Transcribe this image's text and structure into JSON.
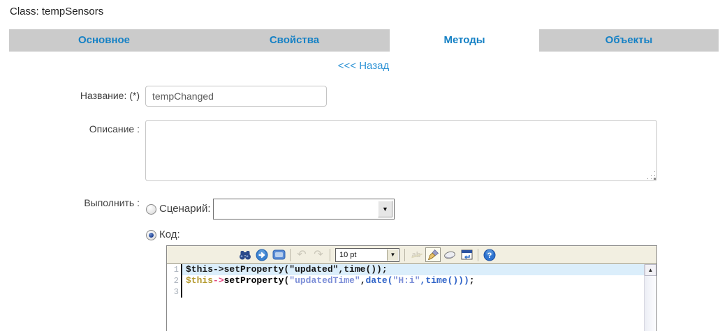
{
  "page": {
    "title": "Class: tempSensors"
  },
  "tabs": [
    {
      "label": "Основное",
      "active": false
    },
    {
      "label": "Свойства",
      "active": false
    },
    {
      "label": "Методы",
      "active": true
    },
    {
      "label": "Объекты",
      "active": false
    }
  ],
  "back_link": "<<< Назад",
  "form": {
    "name_label": "Название: (*)",
    "name_value": "tempChanged",
    "description_label": "Описание :",
    "description_value": "",
    "execute_label": "Выполнить :",
    "scenario_label": "Сценарий:",
    "scenario_selected_value": "",
    "scenario_radio_checked": false,
    "code_label": "Код:",
    "code_radio_checked": true
  },
  "editor": {
    "toolbar": {
      "icons": [
        "search",
        "go-to-line",
        "fullscreen",
        "undo",
        "redo",
        "font-size-select",
        "smooth-selection",
        "highlight-brush",
        "reset-highlight-eraser",
        "word-wrap",
        "help"
      ],
      "font_size_value": "10 pt",
      "undo_enabled": false,
      "redo_enabled": false,
      "highlight_pressed": true
    },
    "lines": [
      {
        "number": "1",
        "highlighted": true,
        "tokens": [
          {
            "c": "plain",
            "t": "$this->setProperty(\"updated\",time());"
          }
        ]
      },
      {
        "number": "2",
        "highlighted": false,
        "tokens": [
          {
            "c": "var",
            "t": "$this"
          },
          {
            "c": "op",
            "t": "->"
          },
          {
            "c": "fn",
            "t": "setProperty"
          },
          {
            "c": "plain",
            "t": "("
          },
          {
            "c": "str",
            "t": "\"updatedTime\""
          },
          {
            "c": "plain",
            "t": ","
          },
          {
            "c": "call",
            "t": "date"
          },
          {
            "c": "call",
            "t": "("
          },
          {
            "c": "str",
            "t": "\"H:i\""
          },
          {
            "c": "call",
            "t": ","
          },
          {
            "c": "call",
            "t": "time"
          },
          {
            "c": "call",
            "t": "()))"
          },
          {
            "c": "plain",
            "t": ";"
          }
        ]
      },
      {
        "number": "3",
        "highlighted": false,
        "tokens": []
      }
    ],
    "syntax_colors": {
      "variable": "#b49a2e",
      "operator_arrow": "#e0447e",
      "method": "#000000",
      "string": "#7d8fd8",
      "function_call": "#2f63c8",
      "plain": "#151515",
      "line_highlight_bg": "#dbeefb"
    }
  },
  "colors": {
    "tab_bg": "#cbcbcb",
    "tab_active_bg": "#ffffff",
    "tab_text": "#1581c5",
    "link_blue": "#2e93d5",
    "toolbar_bg": "#f2efe1",
    "editor_border": "#8a8a8a"
  }
}
